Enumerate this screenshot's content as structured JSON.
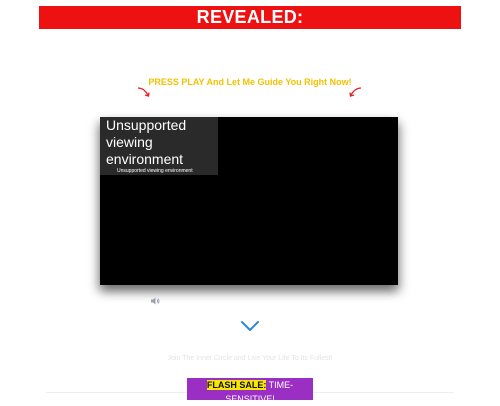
{
  "banner": {
    "text": "REVEALED:"
  },
  "cta": {
    "text": "PRESS PLAY And Let Me Guide You Right Now!"
  },
  "video": {
    "message_title": "Unsupported viewing environment",
    "message_sub": "Unsupported viewing environment"
  },
  "icons": {
    "speaker": "speaker-icon",
    "chevron": "chevron-down-icon",
    "arrow_left": "curved-arrow-left-icon",
    "arrow_right": "curved-arrow-right-icon"
  },
  "section": {
    "heading": "",
    "subline": "Join The Inner Circle and Live Your Life To Its Fullest!"
  },
  "flash": {
    "label": "FLASH SALE:",
    "rest": "TIME-SENSITIVE!"
  },
  "colors": {
    "banner_bg": "#ee1111",
    "cta_text": "#f2c200",
    "arrow": "#e12222",
    "chevron": "#2a8ad4",
    "flash_bg": "#9b2fc4",
    "flash_highlight": "#f6e600"
  }
}
